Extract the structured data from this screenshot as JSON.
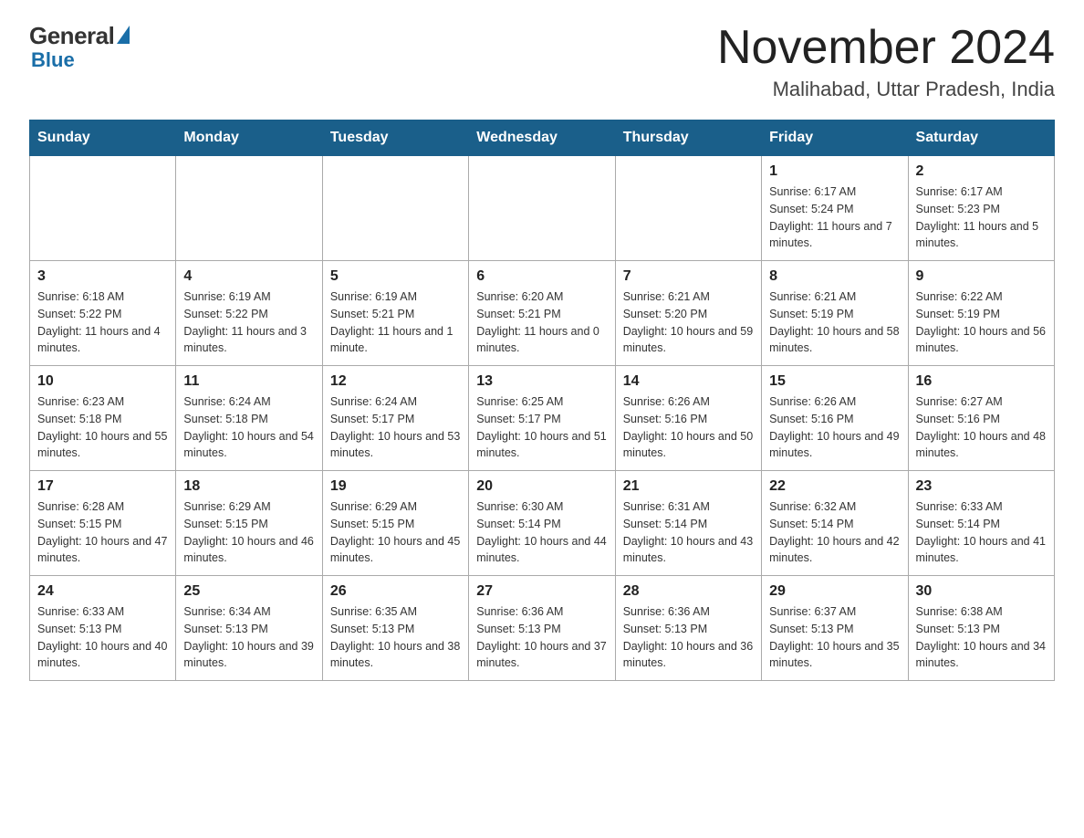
{
  "header": {
    "logo_general": "General",
    "logo_blue": "Blue",
    "month_title": "November 2024",
    "location": "Malihabad, Uttar Pradesh, India"
  },
  "days_of_week": [
    "Sunday",
    "Monday",
    "Tuesday",
    "Wednesday",
    "Thursday",
    "Friday",
    "Saturday"
  ],
  "weeks": [
    [
      {
        "day": "",
        "info": ""
      },
      {
        "day": "",
        "info": ""
      },
      {
        "day": "",
        "info": ""
      },
      {
        "day": "",
        "info": ""
      },
      {
        "day": "",
        "info": ""
      },
      {
        "day": "1",
        "info": "Sunrise: 6:17 AM\nSunset: 5:24 PM\nDaylight: 11 hours and 7 minutes."
      },
      {
        "day": "2",
        "info": "Sunrise: 6:17 AM\nSunset: 5:23 PM\nDaylight: 11 hours and 5 minutes."
      }
    ],
    [
      {
        "day": "3",
        "info": "Sunrise: 6:18 AM\nSunset: 5:22 PM\nDaylight: 11 hours and 4 minutes."
      },
      {
        "day": "4",
        "info": "Sunrise: 6:19 AM\nSunset: 5:22 PM\nDaylight: 11 hours and 3 minutes."
      },
      {
        "day": "5",
        "info": "Sunrise: 6:19 AM\nSunset: 5:21 PM\nDaylight: 11 hours and 1 minute."
      },
      {
        "day": "6",
        "info": "Sunrise: 6:20 AM\nSunset: 5:21 PM\nDaylight: 11 hours and 0 minutes."
      },
      {
        "day": "7",
        "info": "Sunrise: 6:21 AM\nSunset: 5:20 PM\nDaylight: 10 hours and 59 minutes."
      },
      {
        "day": "8",
        "info": "Sunrise: 6:21 AM\nSunset: 5:19 PM\nDaylight: 10 hours and 58 minutes."
      },
      {
        "day": "9",
        "info": "Sunrise: 6:22 AM\nSunset: 5:19 PM\nDaylight: 10 hours and 56 minutes."
      }
    ],
    [
      {
        "day": "10",
        "info": "Sunrise: 6:23 AM\nSunset: 5:18 PM\nDaylight: 10 hours and 55 minutes."
      },
      {
        "day": "11",
        "info": "Sunrise: 6:24 AM\nSunset: 5:18 PM\nDaylight: 10 hours and 54 minutes."
      },
      {
        "day": "12",
        "info": "Sunrise: 6:24 AM\nSunset: 5:17 PM\nDaylight: 10 hours and 53 minutes."
      },
      {
        "day": "13",
        "info": "Sunrise: 6:25 AM\nSunset: 5:17 PM\nDaylight: 10 hours and 51 minutes."
      },
      {
        "day": "14",
        "info": "Sunrise: 6:26 AM\nSunset: 5:16 PM\nDaylight: 10 hours and 50 minutes."
      },
      {
        "day": "15",
        "info": "Sunrise: 6:26 AM\nSunset: 5:16 PM\nDaylight: 10 hours and 49 minutes."
      },
      {
        "day": "16",
        "info": "Sunrise: 6:27 AM\nSunset: 5:16 PM\nDaylight: 10 hours and 48 minutes."
      }
    ],
    [
      {
        "day": "17",
        "info": "Sunrise: 6:28 AM\nSunset: 5:15 PM\nDaylight: 10 hours and 47 minutes."
      },
      {
        "day": "18",
        "info": "Sunrise: 6:29 AM\nSunset: 5:15 PM\nDaylight: 10 hours and 46 minutes."
      },
      {
        "day": "19",
        "info": "Sunrise: 6:29 AM\nSunset: 5:15 PM\nDaylight: 10 hours and 45 minutes."
      },
      {
        "day": "20",
        "info": "Sunrise: 6:30 AM\nSunset: 5:14 PM\nDaylight: 10 hours and 44 minutes."
      },
      {
        "day": "21",
        "info": "Sunrise: 6:31 AM\nSunset: 5:14 PM\nDaylight: 10 hours and 43 minutes."
      },
      {
        "day": "22",
        "info": "Sunrise: 6:32 AM\nSunset: 5:14 PM\nDaylight: 10 hours and 42 minutes."
      },
      {
        "day": "23",
        "info": "Sunrise: 6:33 AM\nSunset: 5:14 PM\nDaylight: 10 hours and 41 minutes."
      }
    ],
    [
      {
        "day": "24",
        "info": "Sunrise: 6:33 AM\nSunset: 5:13 PM\nDaylight: 10 hours and 40 minutes."
      },
      {
        "day": "25",
        "info": "Sunrise: 6:34 AM\nSunset: 5:13 PM\nDaylight: 10 hours and 39 minutes."
      },
      {
        "day": "26",
        "info": "Sunrise: 6:35 AM\nSunset: 5:13 PM\nDaylight: 10 hours and 38 minutes."
      },
      {
        "day": "27",
        "info": "Sunrise: 6:36 AM\nSunset: 5:13 PM\nDaylight: 10 hours and 37 minutes."
      },
      {
        "day": "28",
        "info": "Sunrise: 6:36 AM\nSunset: 5:13 PM\nDaylight: 10 hours and 36 minutes."
      },
      {
        "day": "29",
        "info": "Sunrise: 6:37 AM\nSunset: 5:13 PM\nDaylight: 10 hours and 35 minutes."
      },
      {
        "day": "30",
        "info": "Sunrise: 6:38 AM\nSunset: 5:13 PM\nDaylight: 10 hours and 34 minutes."
      }
    ]
  ]
}
